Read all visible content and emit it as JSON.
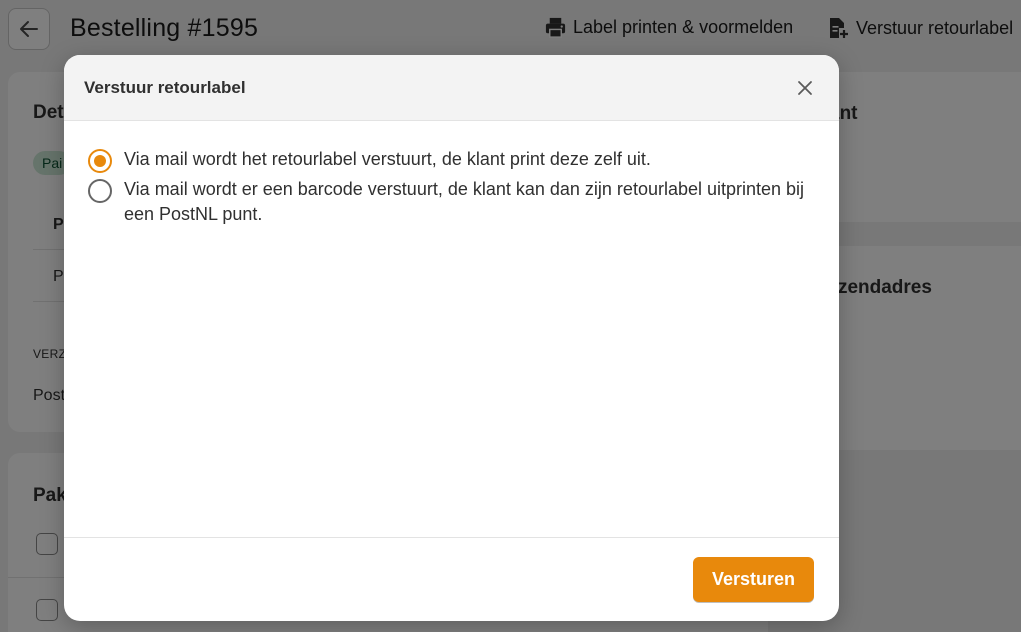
{
  "page": {
    "title": "Bestelling #1595",
    "actions": [
      {
        "label": "Label printen & voormelden",
        "icon": "printer-icon"
      },
      {
        "label": "Verstuur retourlabel",
        "icon": "document-plus-icon"
      }
    ],
    "details_card": {
      "title_fragment": "Det",
      "badge_fragment": "Pai",
      "row1_fragment": "P",
      "row2_fragment": "P",
      "verzend_fragment": "VERZ",
      "post_fragment": "Post"
    },
    "pakket_card": {
      "title_fragment": "Pak"
    },
    "klant_card": {
      "title_fragment": "ant"
    },
    "verzendadres_card": {
      "title_fragment": "erzendadres"
    }
  },
  "modal": {
    "title": "Verstuur retourlabel",
    "close_icon": "close-icon",
    "options": [
      {
        "label": "Via mail wordt het retourlabel verstuurt, de klant print deze zelf uit.",
        "selected": true
      },
      {
        "label": "Via mail wordt er een barcode verstuurt, de klant kan dan zijn retourlabel uitprinten bij een PostNL punt.",
        "selected": false
      }
    ],
    "submit_label": "Versturen"
  },
  "colors": {
    "accent": "#e8890c",
    "overlay": "rgba(0,0,0,0.5)",
    "badge_bg": "#cde9d6"
  }
}
